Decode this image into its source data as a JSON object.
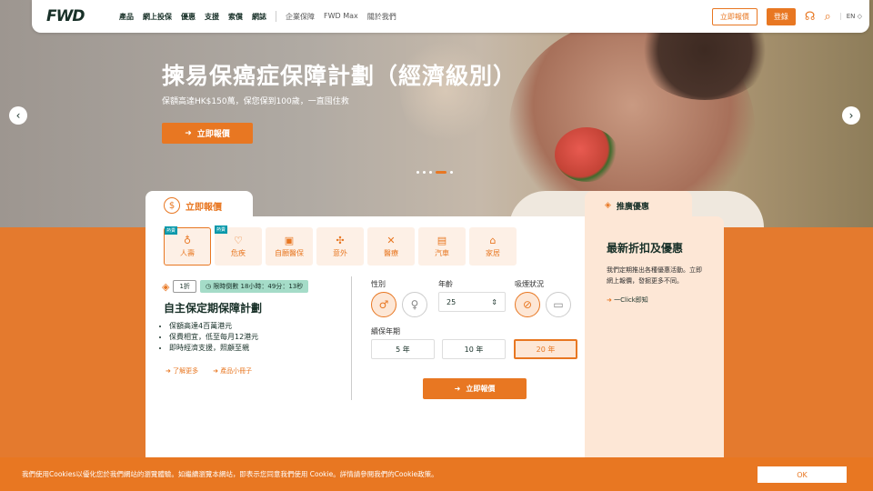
{
  "nav": {
    "logo": "FWD",
    "items": [
      "產品",
      "網上投保",
      "優惠",
      "支援",
      "索償",
      "網誌"
    ],
    "items2": [
      "企業保障",
      "FWD Max",
      "關於我們"
    ],
    "quote_btn": "立即報價",
    "login_btn": "登錄",
    "lang": "EN"
  },
  "hero": {
    "title": "揀易保癌症保障計劃（經濟級別）",
    "subtitle": "保額高達HK$150萬，保您保到100歲，一直囤住救",
    "cta": "立即報價"
  },
  "quote": {
    "tab_label": "立即報價",
    "categories": [
      {
        "label": "人壽",
        "icon": "♁",
        "hot": "熱賣"
      },
      {
        "label": "危疾",
        "icon": "♡",
        "hot": "熱賣"
      },
      {
        "label": "自願醫保",
        "icon": "▣",
        "hot": ""
      },
      {
        "label": "意外",
        "icon": "✣",
        "hot": ""
      },
      {
        "label": "醫療",
        "icon": "✕",
        "hot": ""
      },
      {
        "label": "汽車",
        "icon": "▤",
        "hot": ""
      },
      {
        "label": "家居",
        "icon": "⌂",
        "hot": ""
      }
    ],
    "discount": "1折",
    "timer": "限時倒數 18小時：49分：13秒",
    "plan_title": "自主保定期保障計劃",
    "bullets": [
      "保額高達4百萬港元",
      "保費相宜，低至每月12港元",
      "即時經濟支援，照顧至親"
    ],
    "link1": "了解更多",
    "link2": "產品小冊子",
    "gender_label": "性別",
    "age_label": "年齡",
    "age_value": "25",
    "smoke_label": "吸煙狀況",
    "term_label": "續保年期",
    "terms": [
      "5 年",
      "10 年",
      "20 年"
    ],
    "submit": "立即報價"
  },
  "promo": {
    "tab_label": "推廣優惠",
    "title": "最新折扣及優惠",
    "body": "我們定期推出各種優惠活動。立即網上報價，發掘更多不同。",
    "link": "一Click即知"
  },
  "cookie": {
    "text": "我們使用Cookies以優化您於我們網站的瀏覽體驗。如繼續瀏覽本網站，即表示您同意我們使用 Cookie。詳情請參閱我們的Cookie政策。",
    "ok": "OK"
  },
  "colors": {
    "accent": "#e87722",
    "dark": "#183028"
  }
}
